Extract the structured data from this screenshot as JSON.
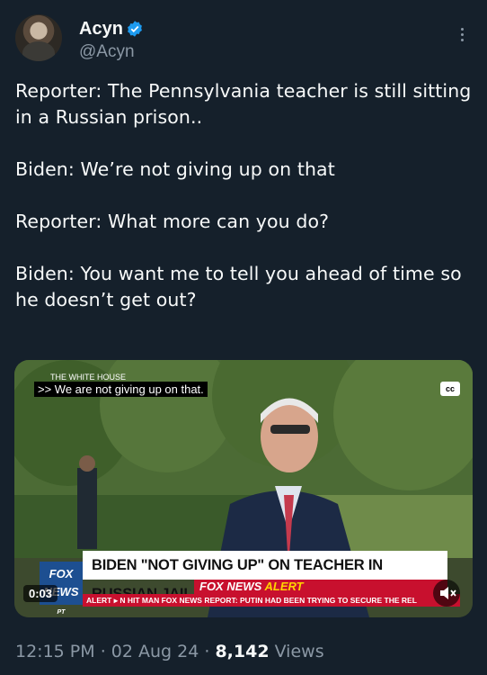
{
  "author": {
    "display_name": "Acyn",
    "handle": "@Acyn",
    "verified_icon": "verified-badge-icon"
  },
  "tweet": {
    "paragraphs": [
      "Reporter: The Pennsylvania teacher is still sitting in a Russian prison..",
      "Biden: We’re not giving up on that",
      "Reporter: What more can you do?",
      "Biden: You want me to tell you ahead of time so he doesn’t get out?"
    ]
  },
  "media": {
    "caption": ">> We are not giving up on that.",
    "cc_label": "cc",
    "top_sign": "THE WHITE HOUSE",
    "chyron": "BIDEN \"NOT GIVING UP\" ON TEACHER IN RUSSIAN JAIL",
    "alert_brand": "FOX NEWS",
    "alert_word": "ALERT",
    "ticker_prefix": "ALERT ▸",
    "ticker": "N HIT MAN   FOX NEWS REPORT: PUTIN HAD BEEN TRYING TO SECURE THE REL",
    "logo": "FOX NEWS",
    "logo_sub": "PT",
    "timestamp": "0:03"
  },
  "meta": {
    "time": "12:15 PM",
    "sep1": " · ",
    "date": "02 Aug 24",
    "sep2": " · ",
    "views_count": "8,142",
    "views_label": " Views"
  },
  "colors": {
    "background": "#15202b",
    "text_primary": "#f7f9f9",
    "text_secondary": "#8b98a5",
    "verified": "#1d9bf0",
    "fox_red": "#c8102e",
    "fox_blue": "#1d4f91"
  }
}
